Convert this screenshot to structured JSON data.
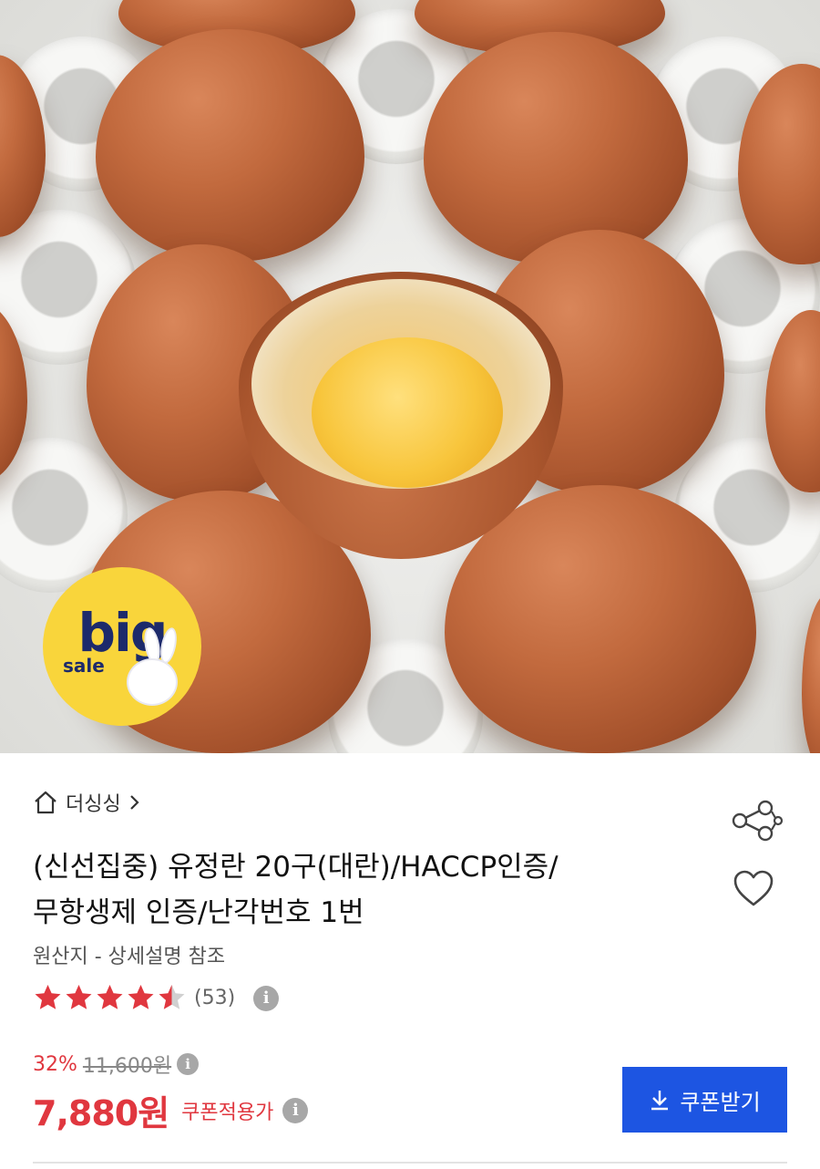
{
  "hero": {
    "badge_big": "big",
    "badge_sale": "sale"
  },
  "seller": {
    "icon": "home-icon",
    "name": "더싱싱",
    "chevron_icon": "chevron-right-icon"
  },
  "product": {
    "title_line1": "(신선집중) 유정란 20구(대란)/HACCP인증/",
    "title_line2": "무항생제 인증/난각번호 1번",
    "origin": "원산지 - 상세설명 참조",
    "rating": 4.5,
    "review_count": "(53)"
  },
  "pricing": {
    "discount_percent": "32%",
    "original_price": "11,600원",
    "price": "7,880원",
    "coupon_note": "쿠폰적용가"
  },
  "actions": {
    "share_icon": "share-icon",
    "wishlist_icon": "heart-icon",
    "coupon_button_label": "쿠폰받기",
    "coupon_button_icon": "download-icon"
  },
  "colors": {
    "accent_red": "#e0373f",
    "button_blue": "#1d55e2",
    "star_red": "#e0373f"
  }
}
